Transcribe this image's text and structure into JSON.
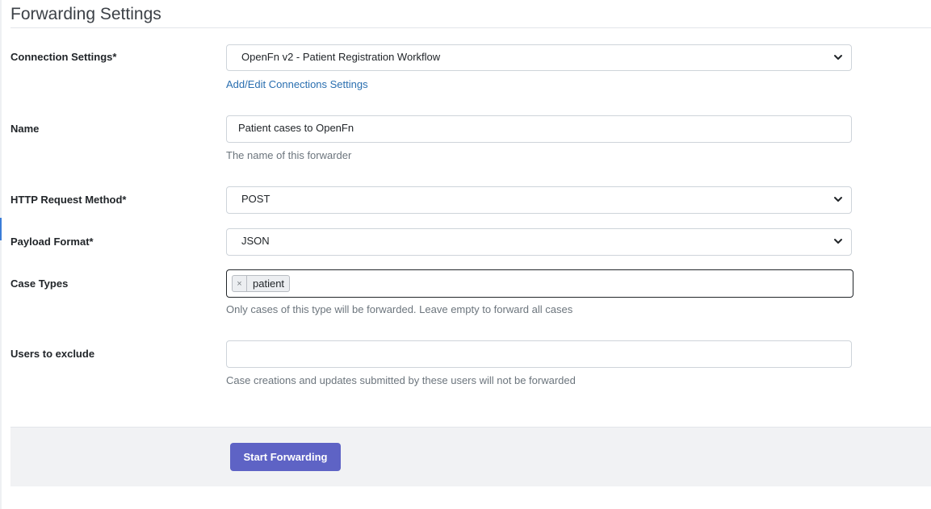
{
  "page_title": "Forwarding Settings",
  "connection": {
    "label": "Connection Settings*",
    "selected": "OpenFn v2 - Patient Registration Workflow",
    "link": "Add/Edit Connections Settings"
  },
  "name": {
    "label": "Name",
    "value": "Patient cases to OpenFn",
    "help": "The name of this forwarder"
  },
  "http_method": {
    "label": "HTTP Request Method*",
    "selected": "POST"
  },
  "payload_format": {
    "label": "Payload Format*",
    "selected": "JSON"
  },
  "case_types": {
    "label": "Case Types",
    "tags": [
      {
        "remove": "×",
        "label": "patient"
      }
    ],
    "help": "Only cases of this type will be forwarded. Leave empty to forward all cases"
  },
  "users_exclude": {
    "label": "Users to exclude",
    "value": "",
    "help": "Case creations and updates submitted by these users will not be forwarded"
  },
  "actions": {
    "submit_label": "Start Forwarding"
  },
  "icons": {
    "select_arrow": "chevron-down-icon",
    "tag_remove": "close-icon"
  },
  "colors": {
    "primary_button": "#5e63c5",
    "link": "#2a6fb0",
    "help_text": "#6c757d"
  }
}
